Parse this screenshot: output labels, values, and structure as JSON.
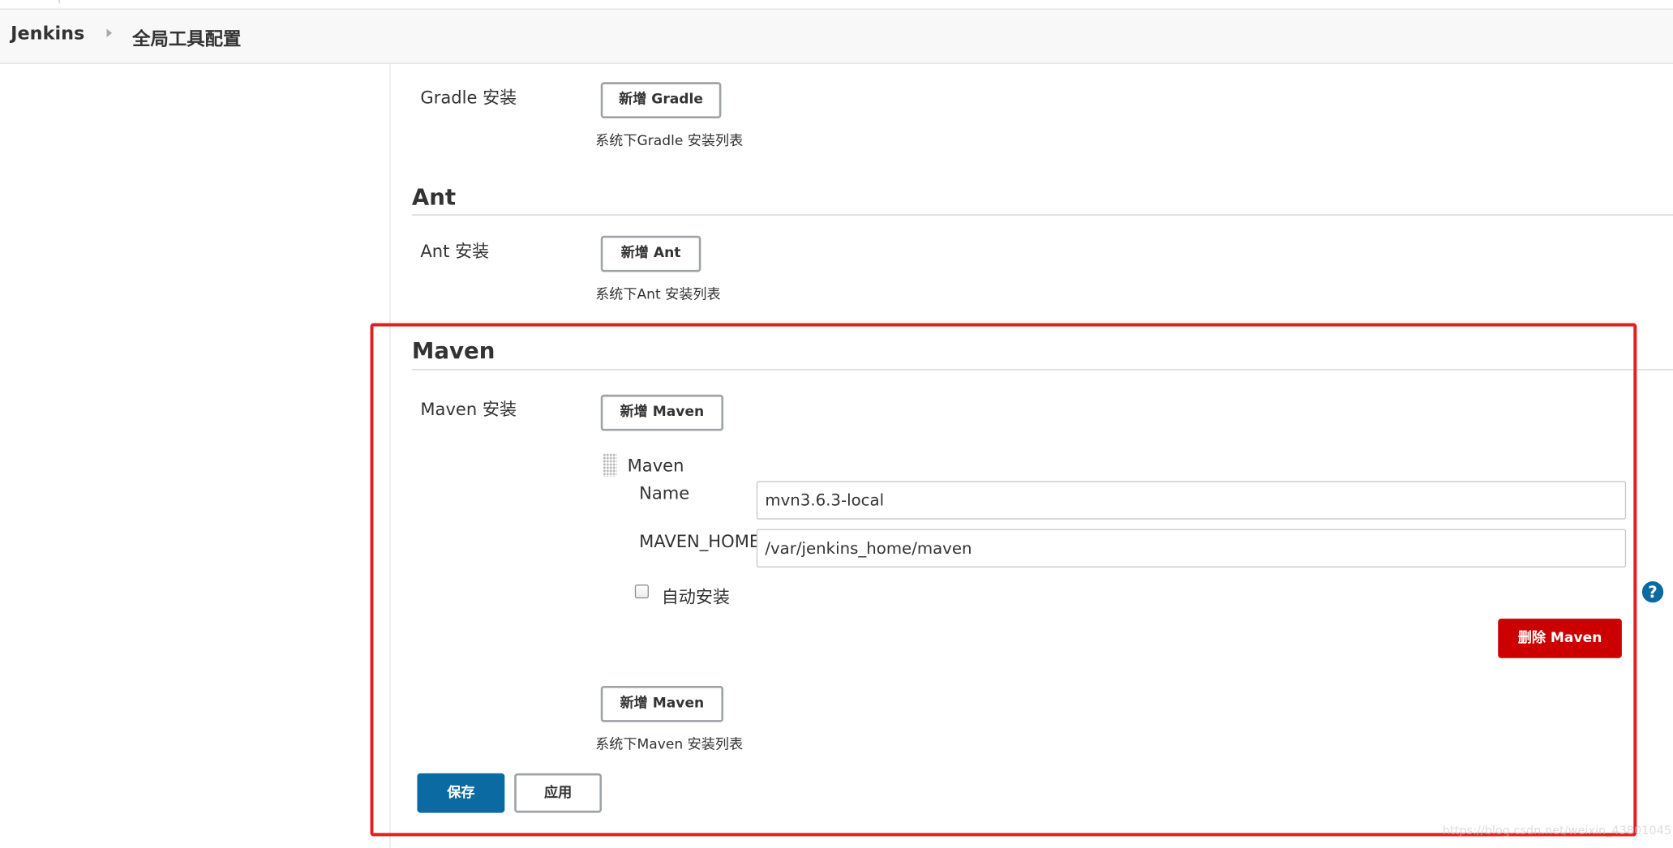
{
  "breadcrumb": {
    "home": "Jenkins",
    "current": "全局工具配置"
  },
  "gradle": {
    "label": "Gradle 安装",
    "add_button": "新增 Gradle",
    "help": "系统下Gradle 安装列表"
  },
  "ant": {
    "title": "Ant",
    "label": "Ant 安装",
    "add_button": "新增 Ant",
    "help": "系统下Ant 安装列表"
  },
  "maven": {
    "title": "Maven",
    "label": "Maven 安装",
    "add_button_top": "新增 Maven",
    "installation": {
      "title": "Maven",
      "name_label": "Name",
      "name_value": "mvn3.6.3-local",
      "home_label": "MAVEN_HOME",
      "home_value": "/var/jenkins_home/maven",
      "auto_install_label": "自动安装",
      "auto_install_checked": false,
      "help_icon": "?",
      "delete_button": "删除 Maven"
    },
    "add_button_bottom": "新增 Maven",
    "help": "系统下Maven 安装列表"
  },
  "actions": {
    "save": "保存",
    "apply": "应用"
  },
  "watermark": "https://blog.csdn.net/weixin_43801045",
  "colors": {
    "primary": "#0b6aa2",
    "danger": "#cc0000",
    "highlight": "#e02020",
    "breadcrumb_bg": "#f8f8f8"
  },
  "icons": {
    "separator": "chevron-right-icon",
    "drag": "drag-handle-icon",
    "help": "help-icon"
  }
}
